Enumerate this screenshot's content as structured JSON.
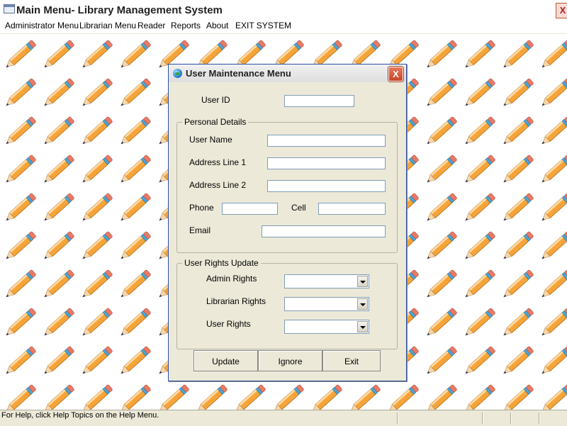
{
  "window": {
    "title": "Main Menu- Library Management System",
    "close_label": "X"
  },
  "menubar": {
    "items": [
      {
        "label": "Administrator Menu"
      },
      {
        "label": "Librarian Menu"
      },
      {
        "label": "Reader"
      },
      {
        "label": "Reports"
      },
      {
        "label": "About"
      },
      {
        "label": "EXIT SYSTEM"
      }
    ]
  },
  "wallpaper": {
    "icon": "pencil-icon",
    "colors": {
      "body": "#f5a43a",
      "tip": "#1f2b5a",
      "band": "#48a7d8"
    }
  },
  "statusbar": {
    "text": "For Help, click Help Topics on the Help Menu."
  },
  "dialog": {
    "title": "User Maintenance Menu",
    "close_label": "X",
    "user_id": {
      "label": "User ID",
      "value": ""
    },
    "personal": {
      "legend": "Personal Details",
      "user_name": {
        "label": "User Name",
        "value": ""
      },
      "address1": {
        "label": "Address Line 1",
        "value": ""
      },
      "address2": {
        "label": "Address Line 2",
        "value": ""
      },
      "phone": {
        "label": "Phone",
        "value": ""
      },
      "cell": {
        "label": "Cell",
        "value": ""
      },
      "email": {
        "label": "Email",
        "value": ""
      }
    },
    "rights": {
      "legend": "User Rights Update",
      "admin": {
        "label": "Admin Rights",
        "value": ""
      },
      "librarian": {
        "label": "Librarian Rights",
        "value": ""
      },
      "user": {
        "label": "User Rights",
        "value": ""
      }
    },
    "buttons": {
      "update": "Update",
      "ignore": "Ignore",
      "exit": "Exit"
    }
  }
}
